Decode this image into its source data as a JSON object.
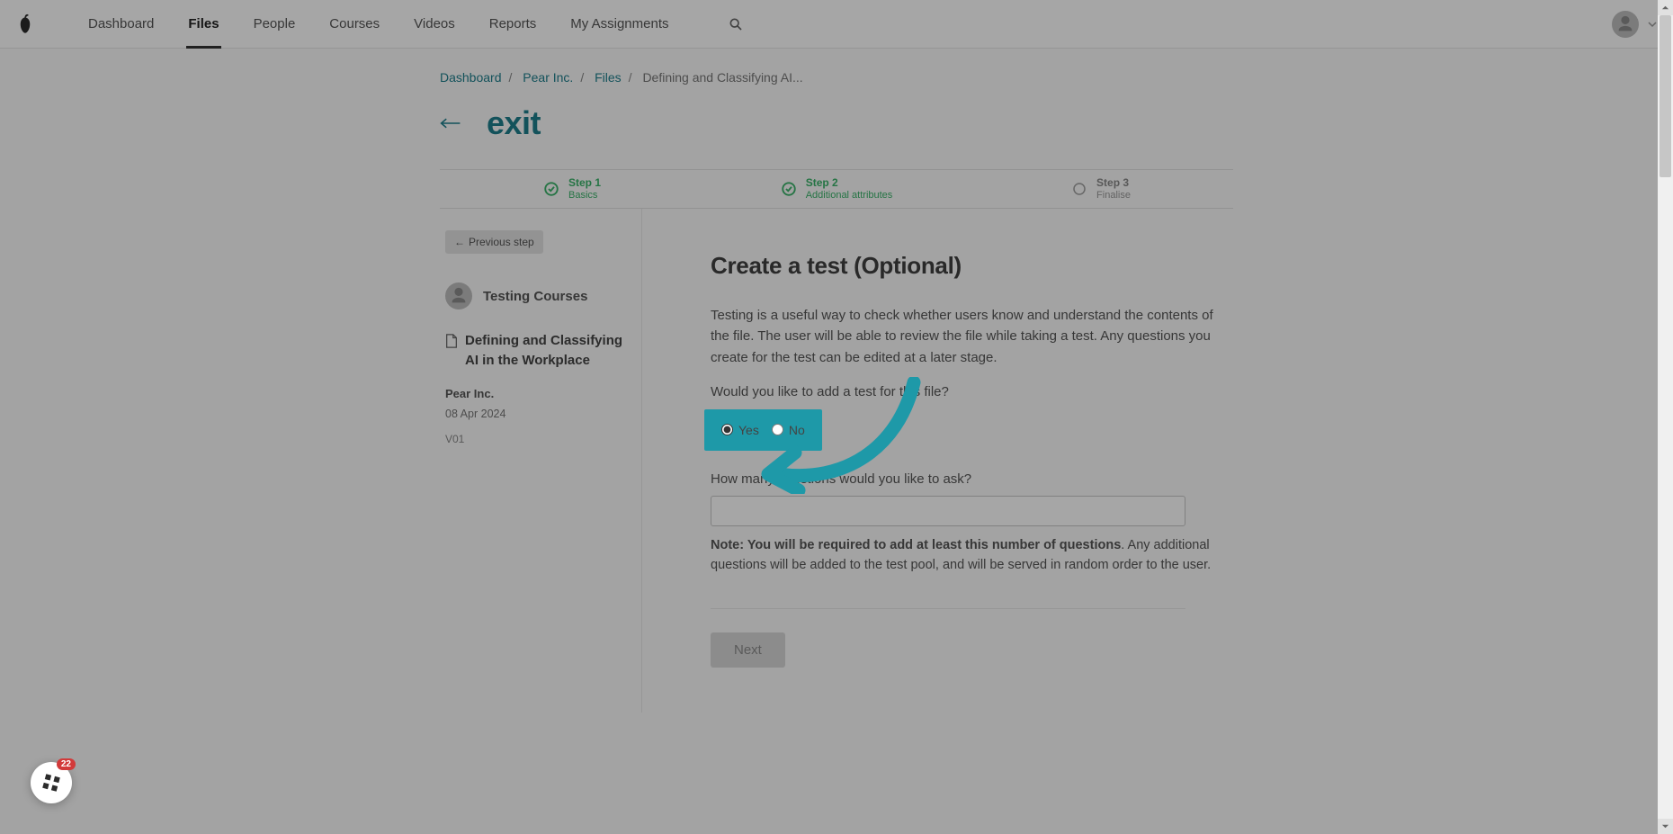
{
  "nav": {
    "items": [
      "Dashboard",
      "Files",
      "People",
      "Courses",
      "Videos",
      "Reports",
      "My Assignments"
    ],
    "active_index": 1
  },
  "breadcrumbs": {
    "items": [
      "Dashboard",
      "Pear Inc.",
      "Files"
    ],
    "current": "Defining and Classifying AI..."
  },
  "exit_label": "exit",
  "stepper": [
    {
      "title": "Step 1",
      "sub": "Basics",
      "status": "done"
    },
    {
      "title": "Step 2",
      "sub": "Additional attributes",
      "status": "done"
    },
    {
      "title": "Step 3",
      "sub": "Finalise",
      "status": "pending"
    }
  ],
  "side": {
    "prev_label": "Previous step",
    "author": "Testing Courses",
    "file_name": "Defining and Classifying AI in the Workplace",
    "company": "Pear Inc.",
    "date": "08 Apr 2024",
    "version": "V01"
  },
  "main": {
    "heading": "Create a test (Optional)",
    "intro": "Testing is a useful way to check whether users know and understand the contents of the file. The user will be able to review the file while taking a test. Any questions you create for the test can be edited at a later stage.",
    "question1": "Would you like to add a test for this file?",
    "yes_label": "Yes",
    "no_label": "No",
    "radio_selected": "yes",
    "question2": "How many questions would you like to ask?",
    "questions_value": "",
    "note_bold": "Note: You will be required to add at least this number of questions",
    "note_rest": ". Any additional questions will be added to the test pool, and will be served in random order to the user.",
    "next_label": "Next"
  },
  "widget": {
    "badge": "22"
  },
  "colors": {
    "accent": "#1e99a8",
    "green": "#3bb36a"
  }
}
